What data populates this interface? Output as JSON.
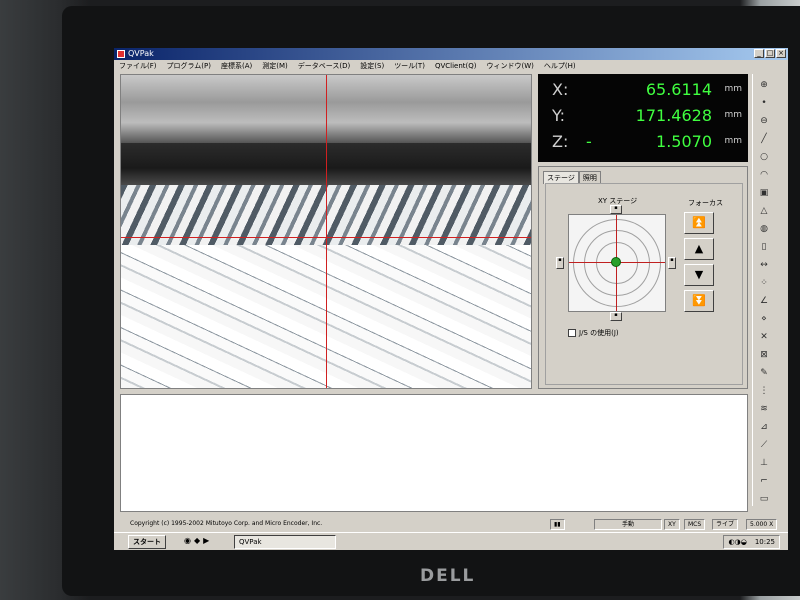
{
  "window": {
    "title": "QVPak"
  },
  "menu": [
    "ファイル(F)",
    "プログラム(P)",
    "座標系(A)",
    "測定(M)",
    "データベース(D)",
    "設定(S)",
    "ツール(T)",
    "QVClient(Q)",
    "ウィンドウ(W)",
    "ヘルプ(H)"
  ],
  "dro": {
    "x": {
      "axis": "X:",
      "sign": "",
      "value": "65.6114",
      "unit": "mm"
    },
    "y": {
      "axis": "Y:",
      "sign": "",
      "value": "171.4628",
      "unit": "mm"
    },
    "z": {
      "axis": "Z:",
      "sign": "-",
      "value": "1.5070",
      "unit": "mm"
    },
    "value_color": "#40ff40"
  },
  "panel": {
    "tabs": [
      "ステージ",
      "照明"
    ],
    "xy_stage_label": "XY ステージ",
    "focus_label": "フォーカス",
    "js_checkbox_label": "J/S の使用(J)"
  },
  "status": {
    "copyright": "Copyright (c) 1995-2002 Mitutoyo Corp. and Micro Encoder, Inc.",
    "mode": "手動",
    "axes": "XY",
    "coord": "MCS",
    "light": "ライブ",
    "zoom": "5.000 X"
  },
  "taskbar": {
    "start": "スタート",
    "task": "QVPak",
    "clock": "10:25"
  },
  "icons": {
    "crosshair_color": "#d02020",
    "stage_dot_color": "#2aa02a"
  }
}
